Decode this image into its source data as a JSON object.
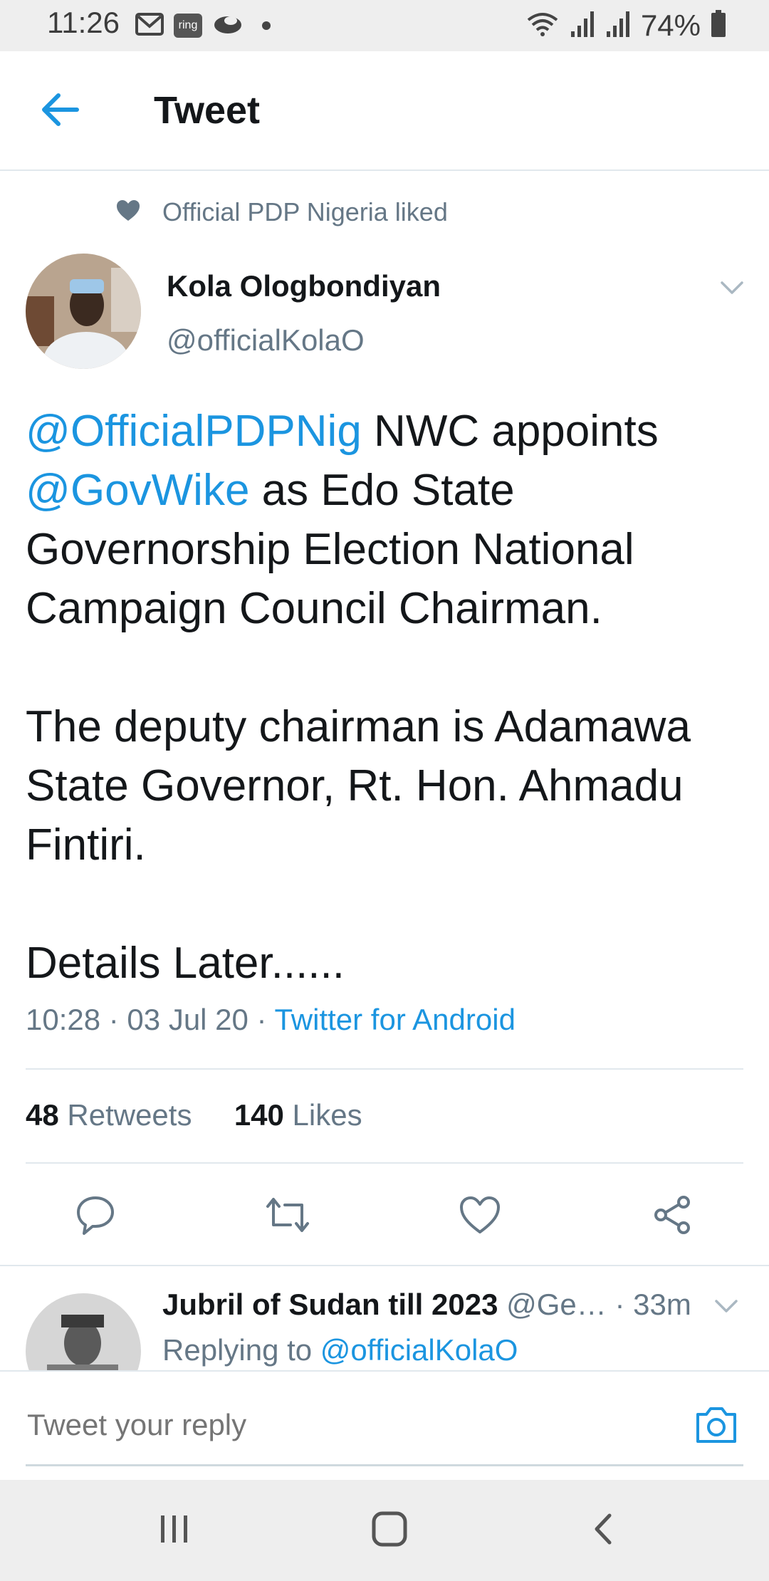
{
  "status_bar": {
    "time": "11:26",
    "battery": "74%",
    "left_icons": [
      "gmail-icon",
      "ring-icon",
      "cloud-icon",
      "dot-icon"
    ],
    "right_icons": [
      "wifi-icon",
      "signal-icon",
      "signal-r-icon",
      "battery-icon"
    ],
    "ring_label": "ring"
  },
  "header": {
    "title": "Tweet"
  },
  "tweet": {
    "social_context": "Official PDP Nigeria liked",
    "author_name": "Kola Ologbondiyan",
    "author_handle": "@officialKolaO",
    "text_p1": {
      "mention1": "@OfficialPDPNig",
      "part1": " NWC appoints ",
      "mention2": "@GovWike",
      "part2": " as Edo State Governorship Election National Campaign Council Chairman."
    },
    "text_p2": "The deputy chairman is Adamawa State Governor, Rt. Hon. Ahmadu Fintiri.",
    "text_p3": "Details Later......",
    "time": "10:28 · 03 Jul 20 · ",
    "source": "Twitter for Android",
    "retweets_count": "48",
    "retweets_label": " Retweets",
    "likes_count": "140",
    "likes_label": " Likes"
  },
  "reply": {
    "name": "Jubril of Sudan till 2023",
    "handle": " @Ge…",
    "time": " · 33m",
    "replying_prefix": "Replying to ",
    "replying_to": "@officialKolaO"
  },
  "compose": {
    "placeholder": "Tweet your reply"
  },
  "colors": {
    "accent": "#1b95e0",
    "text": "#14171a",
    "muted": "#657786",
    "divider": "#e1e8ed"
  }
}
